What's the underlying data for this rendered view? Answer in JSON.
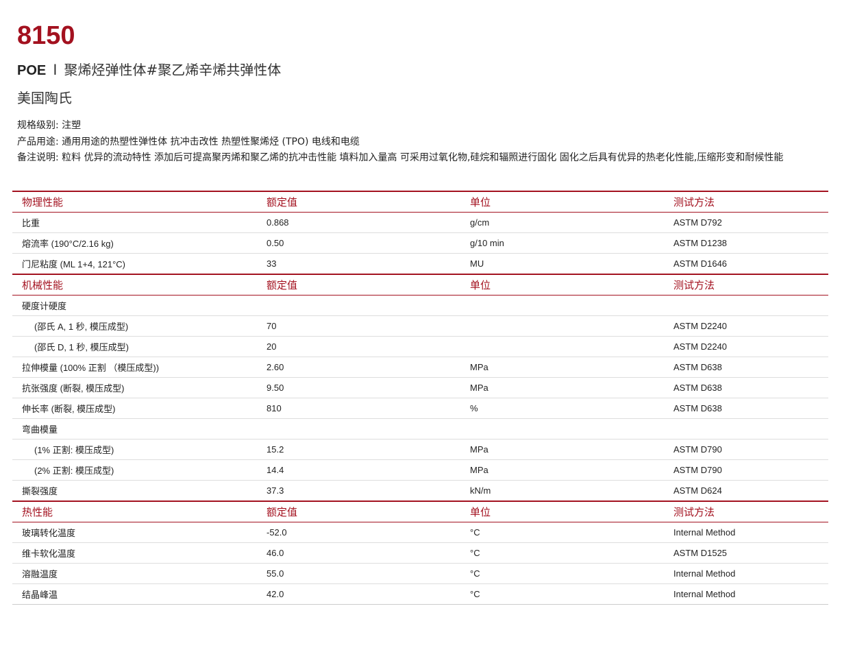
{
  "product": {
    "grade": "8150",
    "type_code": "POE",
    "separator": "l",
    "type_desc": "聚烯烃弹性体#聚乙烯辛烯共弹性体",
    "manufacturer": "美国陶氏"
  },
  "meta": {
    "grade_level": "规格级别: 注塑",
    "usage": "产品用途: 通用用途的热塑性弹性体 抗冲击改性 热塑性聚烯烃 (TPO) 电线和电缆",
    "remarks": "备注说明: 粒料 优异的流动特性 添加后可提高聚丙烯和聚乙烯的抗冲击性能 填料加入量高 可采用过氧化物,硅烷和辐照进行固化 固化之后具有优异的热老化性能,压缩形变和耐候性能"
  },
  "sections": [
    {
      "header": [
        "物理性能",
        "额定值",
        "单位",
        "测试方法"
      ],
      "rows": [
        {
          "name": "比重",
          "value": "0.868",
          "unit": "g/cm",
          "method": "ASTM D792",
          "indent": false
        },
        {
          "name": "熔流率 (190°C/2.16 kg)",
          "value": "0.50",
          "unit": "g/10 min",
          "method": "ASTM D1238",
          "indent": false
        },
        {
          "name": "门尼粘度 (ML 1+4, 121°C)",
          "value": "33",
          "unit": "MU",
          "method": "ASTM D1646",
          "indent": false
        }
      ]
    },
    {
      "header": [
        "机械性能",
        "额定值",
        "单位",
        "测试方法"
      ],
      "rows": [
        {
          "name": "硬度计硬度",
          "value": "",
          "unit": "",
          "method": "",
          "indent": false
        },
        {
          "name": "(邵氏 A, 1 秒, 模压成型)",
          "value": "70",
          "unit": "",
          "method": "ASTM D2240",
          "indent": true
        },
        {
          "name": "(邵氏 D, 1 秒, 模压成型)",
          "value": "20",
          "unit": "",
          "method": "ASTM D2240",
          "indent": true
        },
        {
          "name": "拉伸模量 (100% 正割 （模压成型))",
          "value": "2.60",
          "unit": "MPa",
          "method": "ASTM D638",
          "indent": false
        },
        {
          "name": "抗张强度 (断裂, 模压成型)",
          "value": "9.50",
          "unit": "MPa",
          "method": "ASTM D638",
          "indent": false
        },
        {
          "name": "伸长率 (断裂, 模压成型)",
          "value": "810",
          "unit": "%",
          "method": "ASTM D638",
          "indent": false
        },
        {
          "name": "弯曲模量",
          "value": "",
          "unit": "",
          "method": "",
          "indent": false
        },
        {
          "name": "(1% 正割: 模压成型)",
          "value": "15.2",
          "unit": "MPa",
          "method": "ASTM D790",
          "indent": true
        },
        {
          "name": "(2% 正割: 模压成型)",
          "value": "14.4",
          "unit": "MPa",
          "method": "ASTM D790",
          "indent": true
        },
        {
          "name": "撕裂强度",
          "value": "37.3",
          "unit": "kN/m",
          "method": "ASTM D624",
          "indent": false
        }
      ]
    },
    {
      "header": [
        "热性能",
        "额定值",
        "单位",
        "测试方法"
      ],
      "rows": [
        {
          "name": "玻璃转化温度",
          "value": "-52.0",
          "unit": "°C",
          "method": "Internal Method",
          "indent": false
        },
        {
          "name": "维卡软化温度",
          "value": "46.0",
          "unit": "°C",
          "method": "ASTM D1525",
          "indent": false
        },
        {
          "name": "溶融温度",
          "value": "55.0",
          "unit": "°C",
          "method": "Internal Method",
          "indent": false
        },
        {
          "name": "结晶峰温",
          "value": "42.0",
          "unit": "°C",
          "method": "Internal Method",
          "indent": false
        }
      ]
    }
  ],
  "colors": {
    "accent": "#a3111f",
    "row_border": "#dddddd",
    "text": "#222222"
  }
}
